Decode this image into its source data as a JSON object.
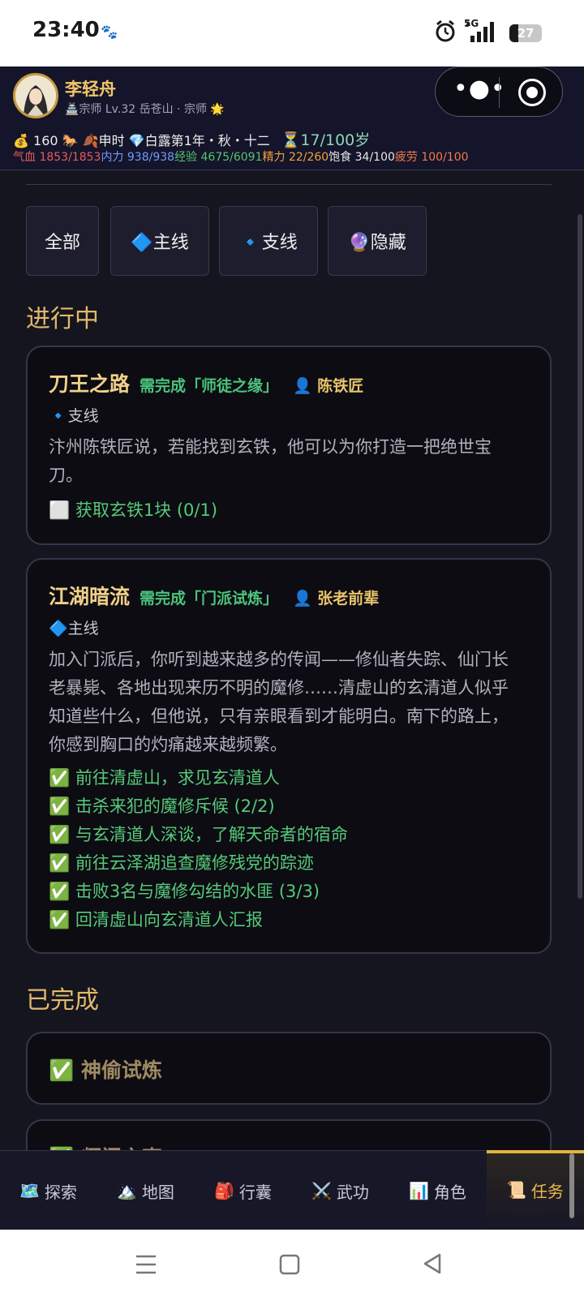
{
  "status_bar": {
    "time": "23:40",
    "network": "5G",
    "battery": "27",
    "battery_level": 0.27
  },
  "profile": {
    "name": "李轻舟",
    "subtitle": "🏯宗师 Lv.32 岳苍山 · 宗师 🌟"
  },
  "resources": {
    "money": "💰 160 🐎 🍂申时 💎白露第1年・秋・十二",
    "age": "⏳17/100岁"
  },
  "stats": [
    {
      "text": "气血 1853/1853",
      "color": "red"
    },
    {
      "text": "内力 938/938",
      "color": "blue"
    },
    {
      "text": "经验 4675/6091",
      "color": "green"
    },
    {
      "text": "精力 22/260",
      "color": "orange"
    },
    {
      "text": "饱食 34/100",
      "color": "white"
    },
    {
      "text": "疲劳 100/100",
      "color": "pink"
    }
  ],
  "filters": [
    "全部",
    "🔷主线",
    "🔹支线",
    "🔮隐藏"
  ],
  "sections": {
    "in_progress": "进行中",
    "completed": "已完成"
  },
  "quests": [
    {
      "name": "刀王之路",
      "requirement": "需完成「师徒之缘」",
      "npc": "👤 陈铁匠",
      "type": "🔹支线",
      "description": "汴州陈铁匠说，若能找到玄铁，他可以为你打造一把绝世宝刀。",
      "objectives": [
        "⬜ 获取玄铁1块 (0/1)"
      ]
    },
    {
      "name": "江湖暗流",
      "requirement": "需完成「门派试炼」",
      "npc": "👤 张老前辈",
      "type": "🔷主线",
      "description": "加入门派后，你听到越来越多的传闻——修仙者失踪、仙门长老暴毙、各地出现来历不明的魔修……清虚山的玄清道人似乎知道些什么，但他说，只有亲眼看到才能明白。南下的路上，你感到胸口的灼痛越来越频繁。",
      "objectives": [
        "✅ 前往清虚山，求见玄清道人",
        "✅ 击杀来犯的魔修斥候 (2/2)",
        "✅ 与玄清道人深谈，了解天命者的宿命",
        "✅ 前往云泽湖追查魔修残党的踪迹",
        "✅ 击败3名与魔修勾结的水匪 (3/3)",
        "✅ 回清虚山向玄清道人汇报"
      ]
    }
  ],
  "completed_quests": [
    "✅ 神偷试炼",
    "✅ 师门之事"
  ],
  "nav": [
    {
      "icon": "🗺️",
      "label": "探索",
      "icon_name": "map-explore-icon"
    },
    {
      "icon": "🏔️",
      "label": "地图",
      "icon_name": "mountain-icon"
    },
    {
      "icon": "🎒",
      "label": "行囊",
      "icon_name": "backpack-icon"
    },
    {
      "icon": "⚔️",
      "label": "武功",
      "icon_name": "swords-icon"
    },
    {
      "icon": "📊",
      "label": "角色",
      "icon_name": "chart-icon"
    },
    {
      "icon": "📜",
      "label": "任务",
      "icon_name": "scroll-icon",
      "active": true
    }
  ],
  "colors": {
    "accent": "#e2b96a",
    "quest_green": "#4bc47c",
    "background": "#15151f"
  }
}
